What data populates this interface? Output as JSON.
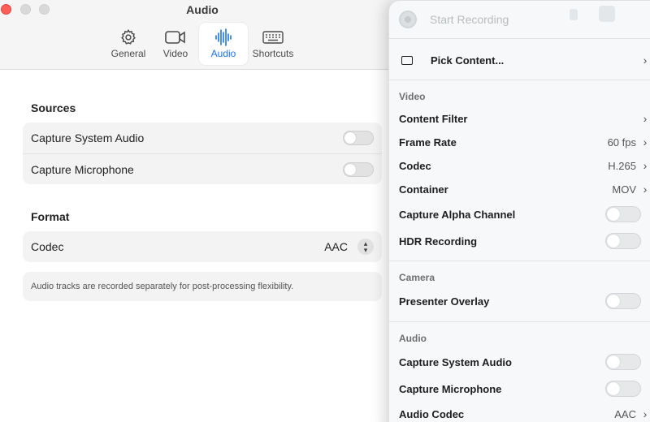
{
  "window": {
    "title": "Audio",
    "tabs": [
      {
        "label": "General",
        "icon": "gear-icon"
      },
      {
        "label": "Video",
        "icon": "video-camera-icon"
      },
      {
        "label": "Audio",
        "icon": "waveform-icon",
        "active": true
      },
      {
        "label": "Shortcuts",
        "icon": "keyboard-icon"
      }
    ]
  },
  "sources": {
    "title": "Sources",
    "items": [
      {
        "label": "Capture System Audio",
        "on": false
      },
      {
        "label": "Capture Microphone",
        "on": false
      }
    ]
  },
  "format": {
    "title": "Format",
    "codec_label": "Codec",
    "codec_value": "AAC",
    "note": "Audio tracks are recorded separately for post-processing flexibility."
  },
  "menu": {
    "start_recording": "Start Recording",
    "pick_content": "Pick Content...",
    "video_section": "Video",
    "content_filter": "Content Filter",
    "frame_rate_label": "Frame Rate",
    "frame_rate_value": "60 fps",
    "codec_label": "Codec",
    "codec_value": "H.265",
    "container_label": "Container",
    "container_value": "MOV",
    "alpha_label": "Capture Alpha Channel",
    "hdr_label": "HDR Recording",
    "camera_section": "Camera",
    "presenter_label": "Presenter Overlay",
    "audio_section": "Audio",
    "system_audio_label": "Capture System Audio",
    "microphone_label": "Capture Microphone",
    "audio_codec_label": "Audio Codec",
    "audio_codec_value": "AAC"
  },
  "colors": {
    "accent": "#1b74e8",
    "close": "#ff5f57"
  }
}
